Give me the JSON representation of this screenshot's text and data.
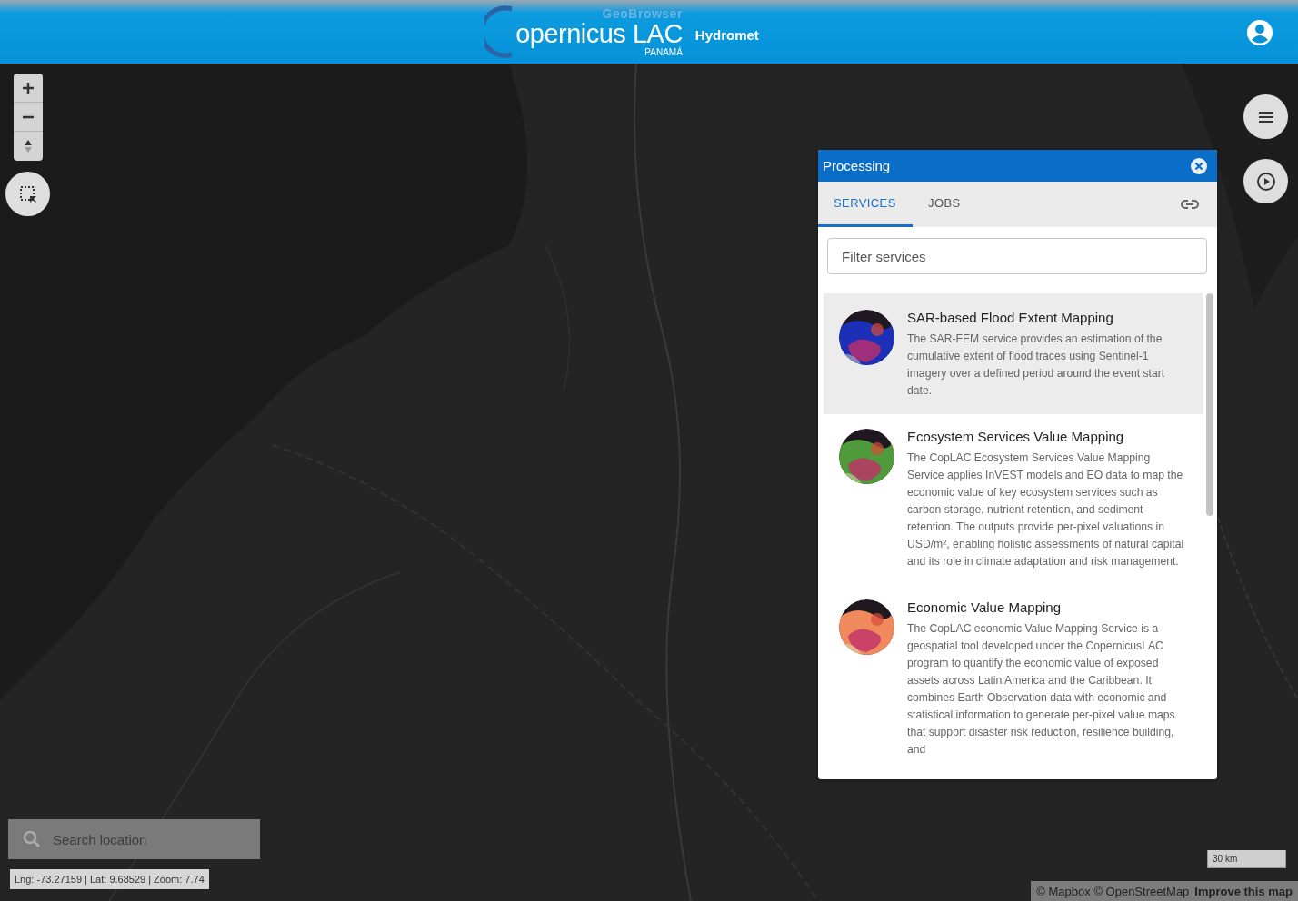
{
  "header": {
    "logo": {
      "top": "GeoBrowser",
      "main": "opernicus LAC",
      "sub": "PANAMÁ"
    },
    "app_name": "Hydromet"
  },
  "search": {
    "placeholder": "Search location"
  },
  "coordinates": "Lng: -73.27159 | Lat: 9.68529 | Zoom: 7.74",
  "scale": "30 km",
  "attribution": {
    "text": "© Mapbox © OpenStreetMap",
    "link": "Improve this map"
  },
  "panel": {
    "title": "Processing",
    "tabs": [
      {
        "label": "SERVICES",
        "selected": true
      },
      {
        "label": "JOBS",
        "selected": false
      }
    ],
    "filter": {
      "placeholder": "Filter services"
    },
    "services": [
      {
        "title": "SAR-based Flood Extent Mapping",
        "description": "The SAR-FEM service provides an estimation of the cumulative extent of flood traces using Sentinel-1 imagery over a defined period around the event start date.",
        "selected": true,
        "color": "#1c2fb8"
      },
      {
        "title": "Ecosystem Services Value Mapping",
        "description": "The CopLAC Ecosystem Services Value Mapping Service applies InVEST models and EO data to map the economic value of key ecosystem services such as carbon storage, nutrient retention, and sediment retention. The outputs provide per-pixel valuations in USD/m², enabling holistic assessments of natural capital and its role in climate adaptation and risk management.",
        "selected": false,
        "color": "#4f9a3a"
      },
      {
        "title": "Economic Value Mapping",
        "description": "The CopLAC economic Value Mapping Service is a geospatial tool developed under the CopernicusLAC program to quantify the economic value of exposed assets across Latin America and the Caribbean. It combines Earth Observation data with economic and statistical information to generate per-pixel value maps that support disaster risk reduction, resilience building, and",
        "selected": false,
        "color": "#f08a5d"
      }
    ]
  }
}
